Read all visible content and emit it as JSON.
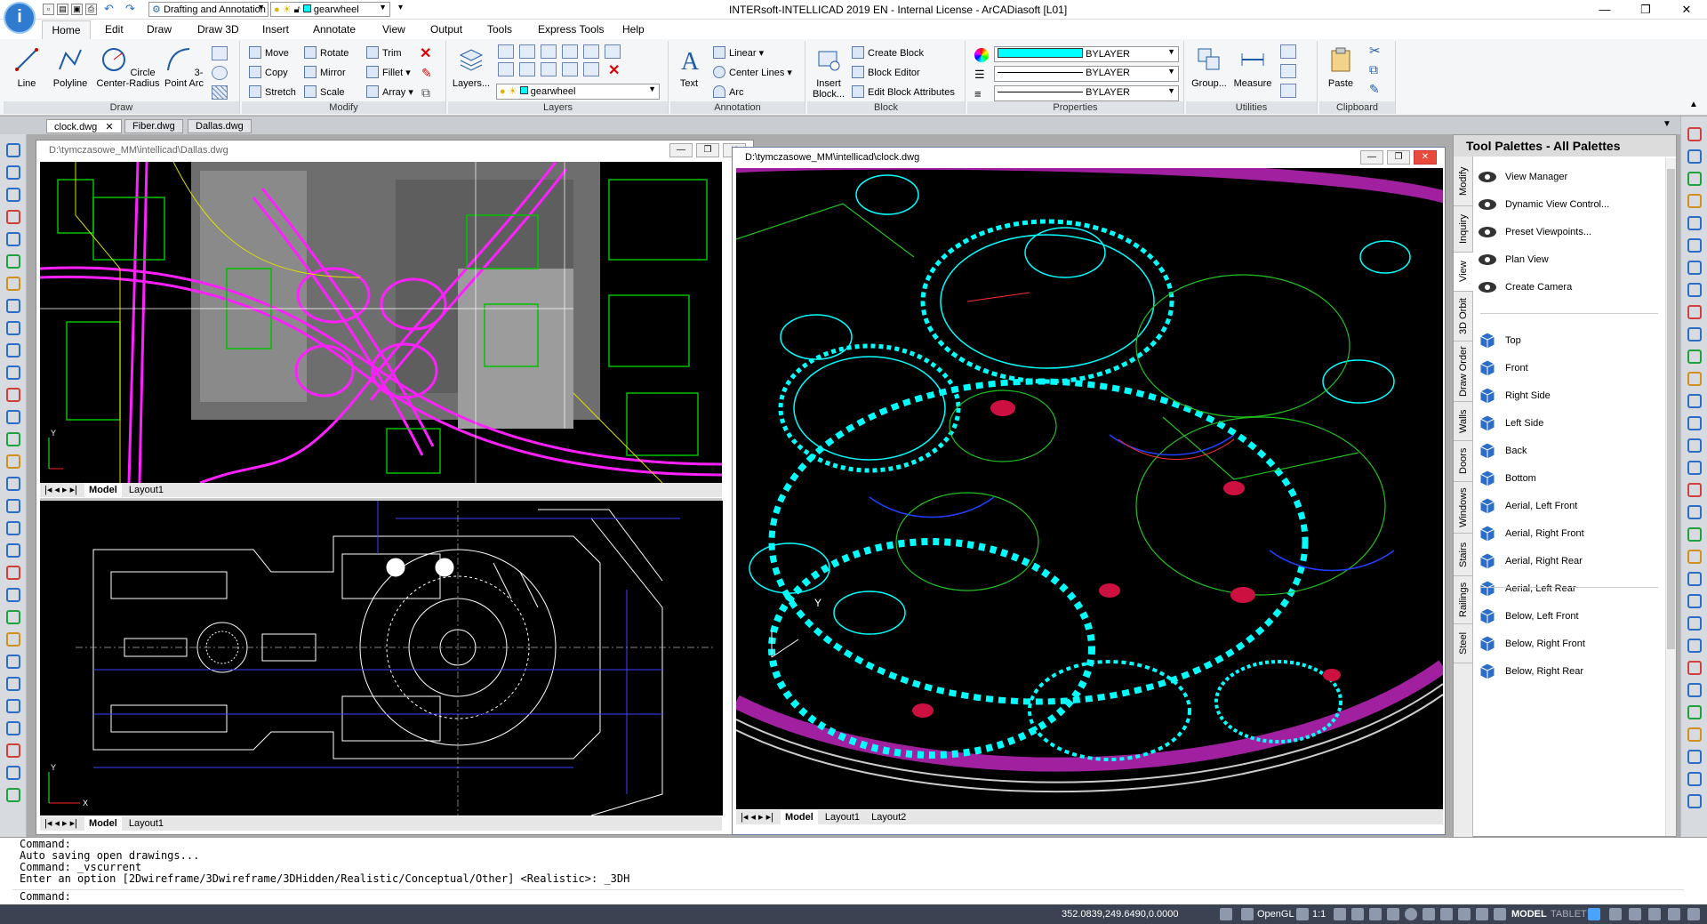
{
  "titlebar": {
    "workspace": "Drafting and Annotation",
    "layer_combo": "gearwheel",
    "title": "INTERsoft-INTELLICAD 2019 EN - Internal License - ArCADiasoft [L01]",
    "minimize": "—",
    "restore": "❐",
    "close": "✕"
  },
  "menu_tabs": [
    "Home",
    "Edit",
    "Draw",
    "Draw 3D",
    "Insert",
    "Annotate",
    "View",
    "Output",
    "Tools",
    "Express Tools",
    "Help"
  ],
  "ribbon": {
    "draw": {
      "line": "Line",
      "polyline": "Polyline",
      "circle": "Circle Center-Radius",
      "arc": "3-Point Arc",
      "caption": "Draw"
    },
    "modify": {
      "move": "Move",
      "rotate": "Rotate",
      "trim": "Trim",
      "copy": "Copy",
      "mirror": "Mirror",
      "fillet": "Fillet",
      "stretch": "Stretch",
      "scale": "Scale",
      "array": "Array",
      "caption": "Modify"
    },
    "layers": {
      "layers_btn": "Layers...",
      "current": "gearwheel",
      "caption": "Layers"
    },
    "annotation": {
      "text": "Text",
      "linear": "Linear",
      "center_lines": "Center Lines",
      "arc": "Arc",
      "caption": "Annotation"
    },
    "block": {
      "insert": "Insert Block...",
      "create": "Create Block",
      "editor": "Block Editor",
      "attributes": "Edit Block Attributes",
      "caption": "Block"
    },
    "properties": {
      "color": "BYLAYER",
      "linetype": "BYLAYER",
      "lineweight": "BYLAYER",
      "caption": "Properties",
      "color_hex": "#00ffff"
    },
    "utilities": {
      "group": "Group...",
      "measure": "Measure",
      "caption": "Utilities"
    },
    "clipboard": {
      "paste": "Paste",
      "caption": "Clipboard"
    }
  },
  "doc_tabs": [
    "clock.dwg",
    "Fiber.dwg",
    "Dallas.dwg"
  ],
  "windows": {
    "dallas": {
      "title": "D:\\tymczasowe_MM\\intellicad\\Dallas.dwg"
    },
    "clock": {
      "title": "D:\\tymczasowe_MM\\intellicad\\clock.dwg"
    }
  },
  "layout_tabs": {
    "model": "Model",
    "layout1": "Layout1",
    "layout2": "Layout2"
  },
  "palette": {
    "title": "Tool Palettes - All Palettes",
    "side_tabs": [
      "Modify",
      "Inquiry",
      "View",
      "3D Orbit",
      "Draw Order",
      "Walls",
      "Doors",
      "Windows",
      "Stairs",
      "Railings",
      "Steel"
    ],
    "items_group1": [
      "View Manager",
      "Dynamic View Control...",
      "Preset Viewpoints...",
      "Plan View",
      "Create Camera"
    ],
    "items_group2": [
      "Top",
      "Front",
      "Right Side",
      "Left Side",
      "Back",
      "Bottom",
      "Aerial, Left Front",
      "Aerial, Right Front",
      "Aerial, Right Rear",
      "Aerial, Left Rear"
    ],
    "items_group3": [
      "Below, Left Front",
      "Below, Right Front",
      "Below, Right Rear"
    ]
  },
  "command": {
    "lines": [
      "Command:",
      "Auto saving open drawings...",
      "Command: _vscurrent",
      "Enter an option [2Dwireframe/3Dwireframe/3DHidden/Realistic/Conceptual/Other] <Realistic>: _3DH"
    ],
    "prompt": "Command:"
  },
  "status": {
    "coords": "352.0839,249.6490,0.0000",
    "opengl": "OpenGL",
    "scale": "1:1",
    "model": "MODEL",
    "tablet": "TABLET"
  },
  "axes": {
    "x": "X",
    "y": "Y"
  }
}
